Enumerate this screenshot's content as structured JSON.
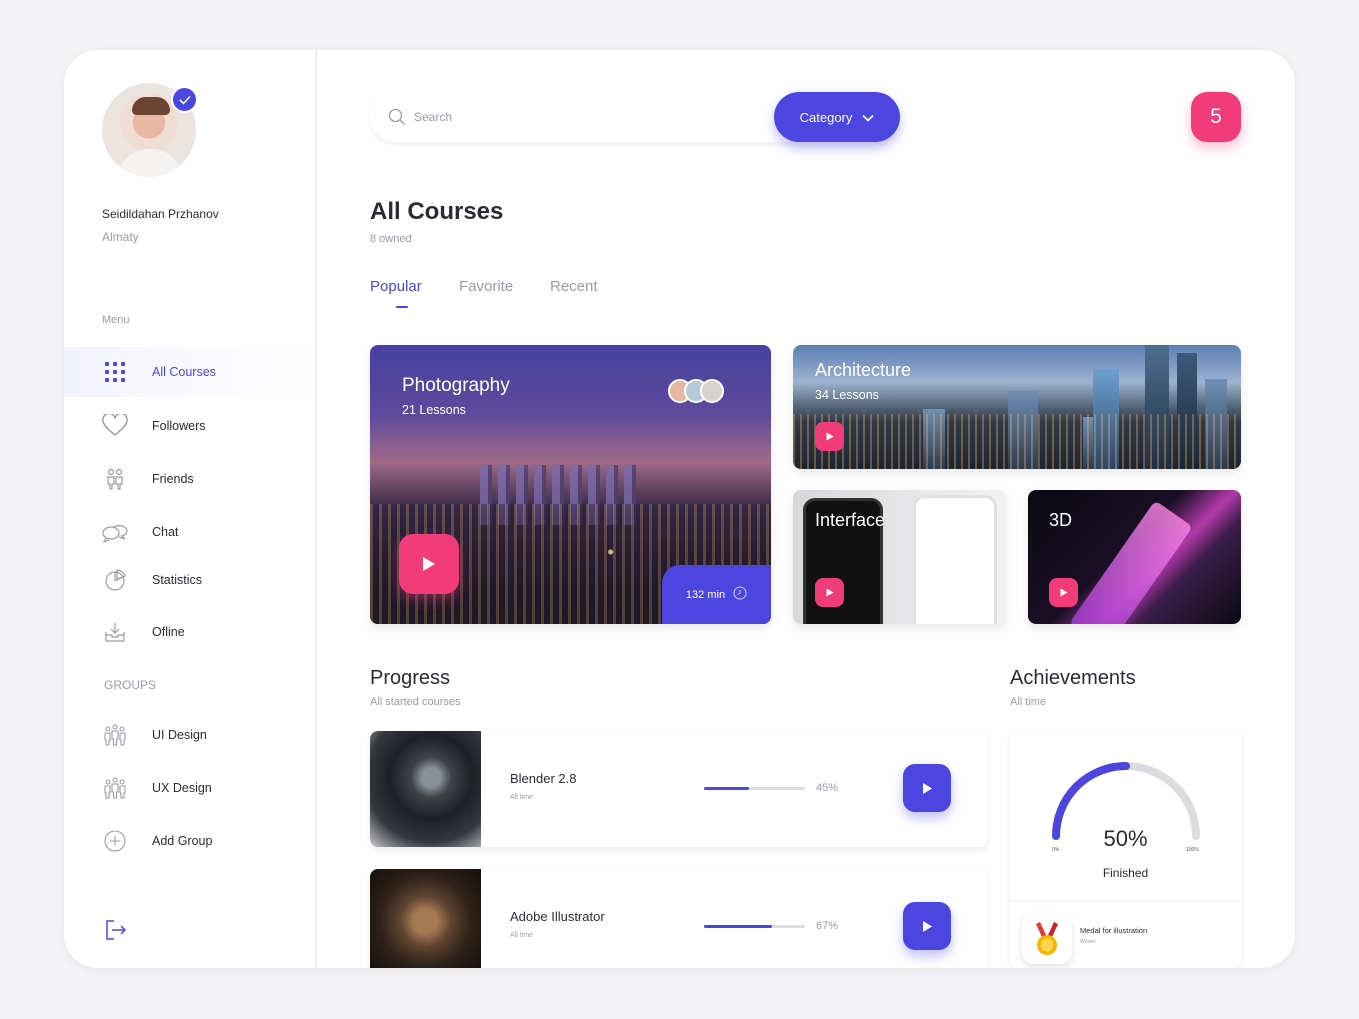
{
  "user": {
    "name": "Seidildahan Przhanov",
    "city": "Almaty"
  },
  "menu": {
    "heading": "Menu",
    "items": [
      {
        "label": "All Courses",
        "icon": "grid-icon",
        "active": true
      },
      {
        "label": "Followers",
        "icon": "heart-icon"
      },
      {
        "label": "Friends",
        "icon": "friends-icon"
      },
      {
        "label": "Chat",
        "icon": "chat-icon"
      },
      {
        "label": "Statistics",
        "icon": "pie-chart-icon"
      },
      {
        "label": "Ofline",
        "icon": "download-icon"
      }
    ]
  },
  "groups": {
    "heading": "GROUPS",
    "items": [
      {
        "label": "UI Design",
        "icon": "people-group-icon"
      },
      {
        "label": "UX Design",
        "icon": "people-group-icon"
      },
      {
        "label": "Add Group",
        "icon": "plus-circle-icon"
      }
    ]
  },
  "search": {
    "placeholder": "Search",
    "value": ""
  },
  "category": {
    "label": "Category"
  },
  "notifications": {
    "count": "5"
  },
  "page": {
    "title": "All Courses",
    "subtitle": "8 owned"
  },
  "tabs": [
    {
      "label": "Popular",
      "active": true
    },
    {
      "label": "Favorite"
    },
    {
      "label": "Recent"
    }
  ],
  "courses": {
    "photography": {
      "title": "Photography",
      "lessons": "21 Lessons",
      "duration": "132 min"
    },
    "architecture": {
      "title": "Architecture",
      "lessons": "34 Lessons"
    },
    "interface": {
      "title": "Interface"
    },
    "threed": {
      "title": "3D"
    }
  },
  "progress": {
    "title": "Progress",
    "subtitle": "All started courses",
    "items": [
      {
        "name": "Blender 2.8",
        "sub": "All time",
        "percent": 45,
        "percent_label": "45%"
      },
      {
        "name": "Adobe Illustrator",
        "sub": "All time",
        "percent": 67,
        "percent_label": "67%"
      }
    ]
  },
  "achievements": {
    "title": "Achievements",
    "subtitle": "All time",
    "gauge_value": 50,
    "gauge_label": "50%",
    "gauge_caption": "Finished",
    "gauge_min": "0%",
    "gauge_max": "100%",
    "medal_name": "Medal for illustration",
    "medal_sub": "Winner"
  },
  "colors": {
    "accent": "#4c46e0",
    "pink": "#f23c7a",
    "muted": "#9a9aa5"
  }
}
